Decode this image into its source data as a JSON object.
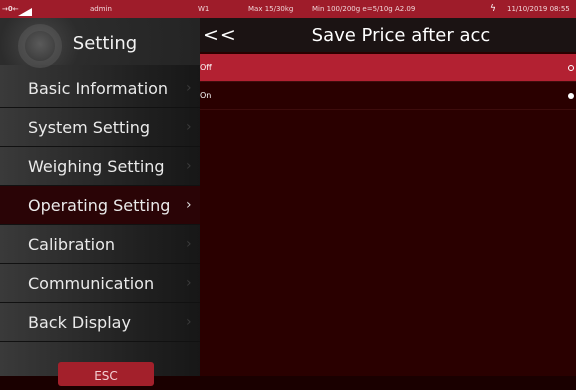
{
  "statusbar": {
    "zero": "→0←",
    "user": "admin",
    "scale": "W1",
    "max": "Max 15/30kg",
    "min": "Min 100/200g e=5/10g A2.09",
    "datetime": "11/10/2019 08:55"
  },
  "sidebar": {
    "title": "Setting",
    "items": [
      {
        "label": "Basic Information",
        "active": false
      },
      {
        "label": "System Setting",
        "active": false
      },
      {
        "label": "Weighing Setting",
        "active": false
      },
      {
        "label": "Operating Setting",
        "active": true
      },
      {
        "label": "Calibration",
        "active": false
      },
      {
        "label": "Communication",
        "active": false
      },
      {
        "label": "Back Display",
        "active": false
      }
    ],
    "esc_label": "ESC"
  },
  "content": {
    "back_label": "<<",
    "title": "Save Price after acc",
    "options": [
      {
        "label": "Off",
        "selected": true
      },
      {
        "label": "On",
        "selected": false
      }
    ]
  },
  "colors": {
    "accent": "#b32132",
    "statusbar": "#9e1c2a",
    "content_bg": "#2a0000"
  },
  "icons": {
    "signal": "signal-icon",
    "power": "lightning-icon",
    "chevron": "chevron-right-icon"
  }
}
